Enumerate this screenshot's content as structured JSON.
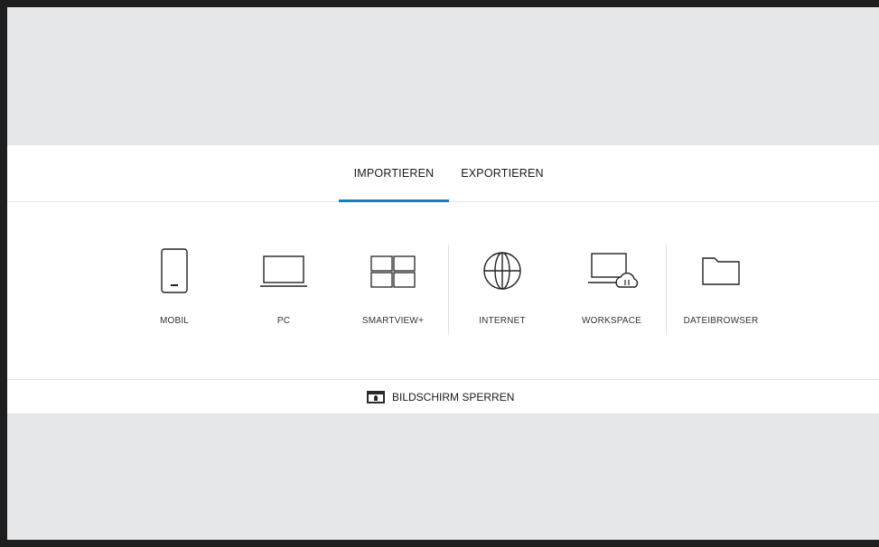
{
  "tabs": [
    {
      "label": "IMPORTIEREN",
      "active": true
    },
    {
      "label": "EXPORTIEREN",
      "active": false
    }
  ],
  "sources": [
    {
      "label": "MOBIL",
      "icon": "smartphone-icon"
    },
    {
      "label": "PC",
      "icon": "laptop-icon"
    },
    {
      "label": "SMARTVIEW+",
      "icon": "grid-icon"
    },
    {
      "label": "INTERNET",
      "icon": "globe-icon"
    },
    {
      "label": "WORKSPACE",
      "icon": "workspace-cloud-icon"
    },
    {
      "label": "DATEIBROWSER",
      "icon": "folder-icon"
    }
  ],
  "lock": {
    "label": "BILDSCHIRM SPERREN",
    "icon": "lock-screen-icon"
  },
  "colors": {
    "accent": "#1f7ac0",
    "background": "#e6e7e9",
    "frame": "#1e1e1e",
    "panel": "#ffffff"
  }
}
